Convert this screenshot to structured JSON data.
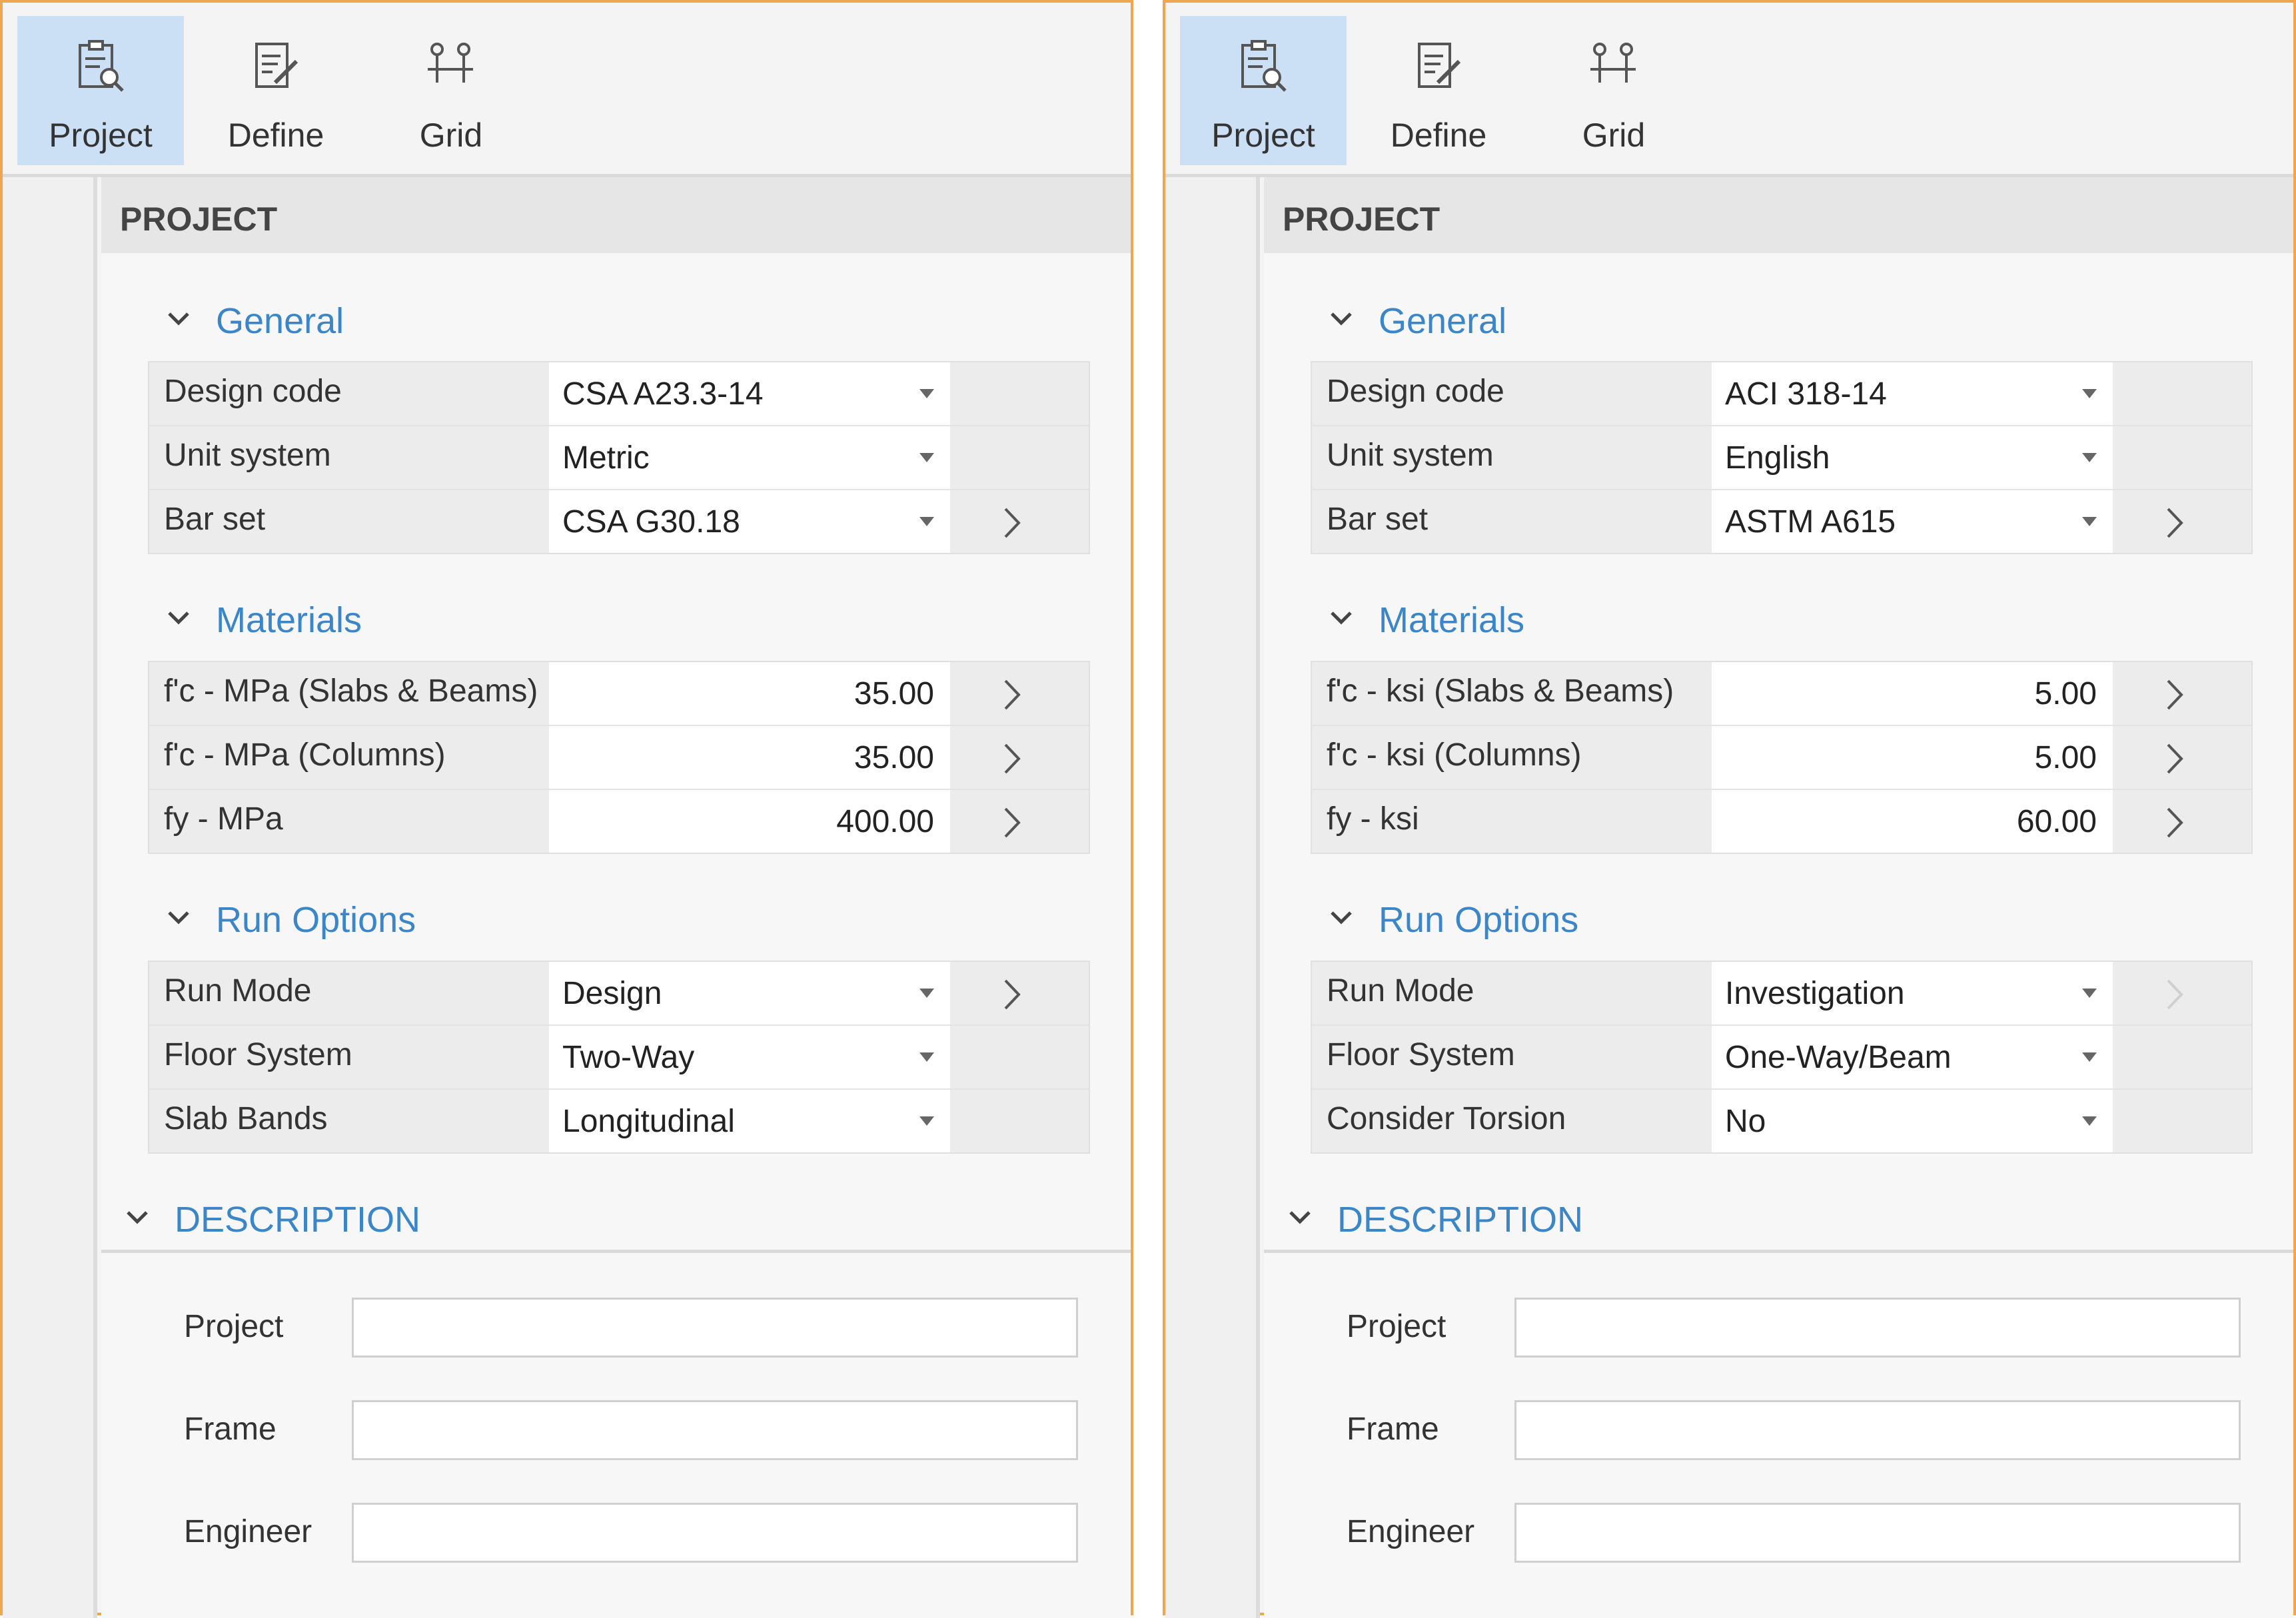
{
  "panels": [
    {
      "toolbar": {
        "project": "Project",
        "define": "Define",
        "grid": "Grid"
      },
      "header": "PROJECT",
      "general": {
        "title": "General",
        "rows": [
          {
            "label": "Design code",
            "value": "CSA A23.3-14"
          },
          {
            "label": "Unit system",
            "value": "Metric"
          },
          {
            "label": "Bar set",
            "value": "CSA G30.18"
          }
        ]
      },
      "materials": {
        "title": "Materials",
        "rows": [
          {
            "label": "f'c - MPa (Slabs & Beams)",
            "value": "35.00"
          },
          {
            "label": "f'c - MPa (Columns)",
            "value": "35.00"
          },
          {
            "label": "fy - MPa",
            "value": "400.00"
          }
        ]
      },
      "run_options": {
        "title": "Run Options",
        "rows": [
          {
            "label": "Run Mode",
            "value": "Design"
          },
          {
            "label": "Floor System",
            "value": "Two-Way"
          },
          {
            "label": "Slab Bands",
            "value": "Longitudinal"
          }
        ]
      },
      "description": {
        "title": "DESCRIPTION",
        "fields": [
          {
            "label": "Project",
            "value": ""
          },
          {
            "label": "Frame",
            "value": ""
          },
          {
            "label": "Engineer",
            "value": ""
          }
        ]
      }
    },
    {
      "toolbar": {
        "project": "Project",
        "define": "Define",
        "grid": "Grid"
      },
      "header": "PROJECT",
      "general": {
        "title": "General",
        "rows": [
          {
            "label": "Design code",
            "value": "ACI 318-14"
          },
          {
            "label": "Unit system",
            "value": "English"
          },
          {
            "label": "Bar set",
            "value": "ASTM A615"
          }
        ]
      },
      "materials": {
        "title": "Materials",
        "rows": [
          {
            "label": "f'c - ksi (Slabs & Beams)",
            "value": "5.00"
          },
          {
            "label": "f'c - ksi (Columns)",
            "value": "5.00"
          },
          {
            "label": "fy - ksi",
            "value": "60.00"
          }
        ]
      },
      "run_options": {
        "title": "Run Options",
        "rows": [
          {
            "label": "Run Mode",
            "value": "Investigation"
          },
          {
            "label": "Floor System",
            "value": "One-Way/Beam"
          },
          {
            "label": "Consider Torsion",
            "value": "No"
          }
        ]
      },
      "description": {
        "title": "DESCRIPTION",
        "fields": [
          {
            "label": "Project",
            "value": ""
          },
          {
            "label": "Frame",
            "value": ""
          },
          {
            "label": "Engineer",
            "value": ""
          }
        ]
      }
    }
  ],
  "colors": {
    "accent": "#3a86c8",
    "panel_border": "#f0a64e",
    "active_tool": "#cce0f5"
  }
}
